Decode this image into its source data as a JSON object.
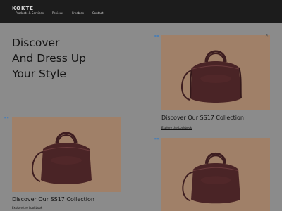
{
  "header": {
    "logo": "KOKTE",
    "nav": [
      "Products & Services",
      "Reviews",
      "Freebies",
      "Contact"
    ]
  },
  "hero": {
    "line1": "Discover",
    "line2": "And Dress Up",
    "line3": "Your Style"
  },
  "cards": [
    {
      "title": "Discover Our SS17 Collection",
      "link": "Explore the Lookbook"
    },
    {
      "title": "Discover Our SS17 Collection",
      "link": "Explore the Lookbook"
    }
  ],
  "colors": {
    "tile": "#a08068",
    "bag": "#4a2426",
    "header_bg": "#1c1c1c",
    "page_bg": "#8b8b8b"
  }
}
